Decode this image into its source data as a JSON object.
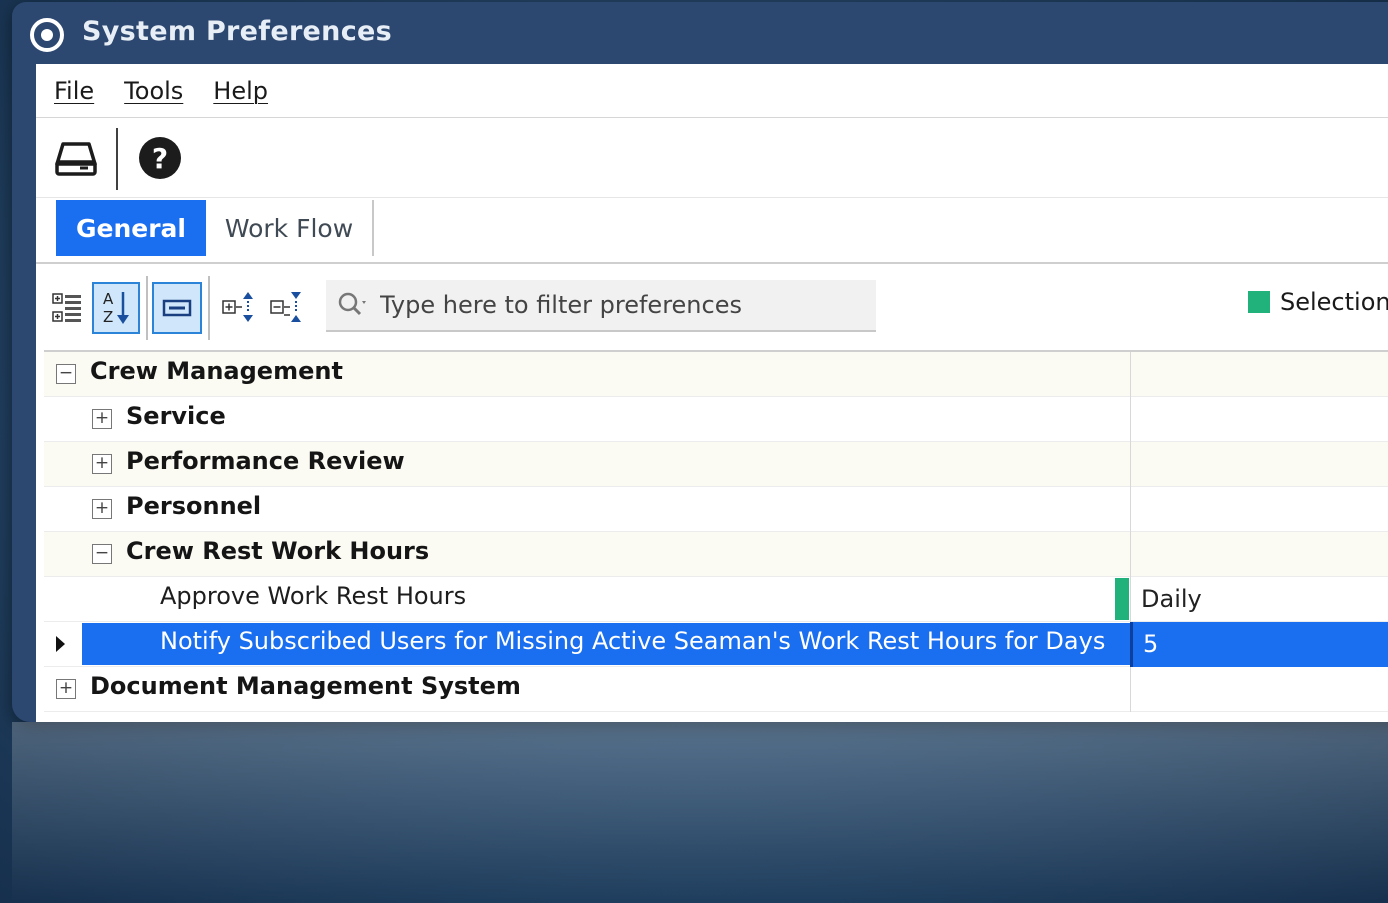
{
  "window": {
    "title": "System Preferences"
  },
  "menu": [
    {
      "label": "File"
    },
    {
      "label": "Tools"
    },
    {
      "label": "Help"
    }
  ],
  "toolbar": {
    "save_icon": "drive-save-icon",
    "help_icon": "help-icon"
  },
  "tabs": [
    {
      "label": "General",
      "active": true
    },
    {
      "label": "Work Flow",
      "active": false
    }
  ],
  "filter": {
    "placeholder": "Type here to filter preferences",
    "value": ""
  },
  "legend": {
    "label": "Selection",
    "color": "#20b27a"
  },
  "tree": {
    "crew_management": {
      "label": "Crew Management",
      "expanded": true
    },
    "service": {
      "label": "Service",
      "expanded": false
    },
    "performance_review": {
      "label": "Performance Review",
      "expanded": false
    },
    "personnel": {
      "label": "Personnel",
      "expanded": false
    },
    "crew_rest": {
      "label": "Crew Rest Work Hours",
      "expanded": true
    },
    "approve": {
      "label": "Approve Work Rest Hours",
      "value": "Daily"
    },
    "notify": {
      "label": "Notify Subscribed Users for Missing Active Seaman's Work Rest Hours for Days",
      "value": "5",
      "selected": true
    },
    "dms": {
      "label": "Document Management System",
      "expanded": false
    }
  },
  "colors": {
    "accent": "#1a6ef0",
    "selection_indicator": "#20b27a",
    "title_bar": "#2c4870"
  }
}
